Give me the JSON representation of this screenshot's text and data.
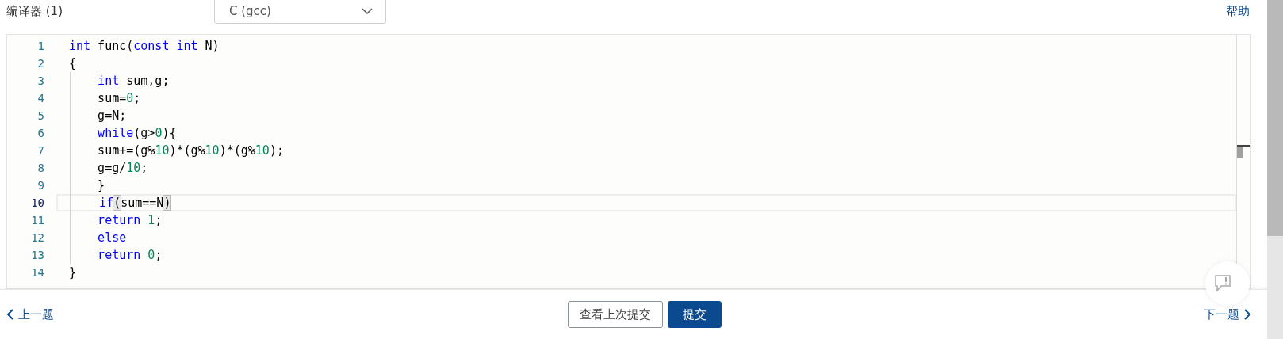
{
  "header": {
    "title": "编译器 (1)",
    "language": "C (gcc)",
    "help": "帮助"
  },
  "editor": {
    "lines": [
      {
        "number": "1",
        "current": false,
        "tokens": [
          {
            "kind": "kw",
            "text": "int"
          },
          {
            "kind": "plain",
            "text": " func("
          },
          {
            "kind": "kw",
            "text": "const"
          },
          {
            "kind": "kw",
            "text": " int"
          },
          {
            "kind": "plain",
            "text": " N)"
          }
        ]
      },
      {
        "number": "2",
        "current": false,
        "tokens": [
          {
            "kind": "plain",
            "text": "{"
          }
        ]
      },
      {
        "number": "3",
        "current": false,
        "tokens": [
          {
            "kind": "kw",
            "text": "    int"
          },
          {
            "kind": "plain",
            "text": " sum,g;"
          }
        ]
      },
      {
        "number": "4",
        "current": false,
        "tokens": [
          {
            "kind": "plain",
            "text": "    sum="
          },
          {
            "kind": "num",
            "text": "0"
          },
          {
            "kind": "plain",
            "text": ";"
          }
        ]
      },
      {
        "number": "5",
        "current": false,
        "tokens": [
          {
            "kind": "plain",
            "text": "    g=N;"
          }
        ]
      },
      {
        "number": "6",
        "current": false,
        "tokens": [
          {
            "kind": "kw",
            "text": "    while"
          },
          {
            "kind": "plain",
            "text": "(g>"
          },
          {
            "kind": "num",
            "text": "0"
          },
          {
            "kind": "plain",
            "text": "){"
          }
        ]
      },
      {
        "number": "7",
        "current": false,
        "tokens": [
          {
            "kind": "plain",
            "text": "    sum+=(g%"
          },
          {
            "kind": "num",
            "text": "10"
          },
          {
            "kind": "plain",
            "text": ")*(g%"
          },
          {
            "kind": "num",
            "text": "10"
          },
          {
            "kind": "plain",
            "text": ")*(g%"
          },
          {
            "kind": "num",
            "text": "10"
          },
          {
            "kind": "plain",
            "text": ");"
          }
        ]
      },
      {
        "number": "8",
        "current": false,
        "tokens": [
          {
            "kind": "plain",
            "text": "    g=g/"
          },
          {
            "kind": "num",
            "text": "10"
          },
          {
            "kind": "plain",
            "text": ";"
          }
        ]
      },
      {
        "number": "9",
        "current": false,
        "tokens": [
          {
            "kind": "plain",
            "text": "    }"
          }
        ]
      },
      {
        "number": "10",
        "current": true,
        "tokens": [
          {
            "kind": "kw",
            "text": "    if"
          },
          {
            "kind": "match",
            "text": "("
          },
          {
            "kind": "plain",
            "text": "sum==N"
          },
          {
            "kind": "match",
            "text": ")"
          }
        ]
      },
      {
        "number": "11",
        "current": false,
        "tokens": [
          {
            "kind": "kw",
            "text": "    return"
          },
          {
            "kind": "num",
            "text": " 1"
          },
          {
            "kind": "plain",
            "text": ";"
          }
        ]
      },
      {
        "number": "12",
        "current": false,
        "tokens": [
          {
            "kind": "kw",
            "text": "    else"
          }
        ]
      },
      {
        "number": "13",
        "current": false,
        "tokens": [
          {
            "kind": "kw",
            "text": "    return"
          },
          {
            "kind": "num",
            "text": " 0"
          },
          {
            "kind": "plain",
            "text": ";"
          }
        ]
      },
      {
        "number": "14",
        "current": false,
        "tokens": [
          {
            "kind": "plain",
            "text": "}"
          }
        ]
      }
    ]
  },
  "footer": {
    "previous": "上一题",
    "view_last": "查看上次提交",
    "submit": "提交",
    "next": "下一题"
  }
}
